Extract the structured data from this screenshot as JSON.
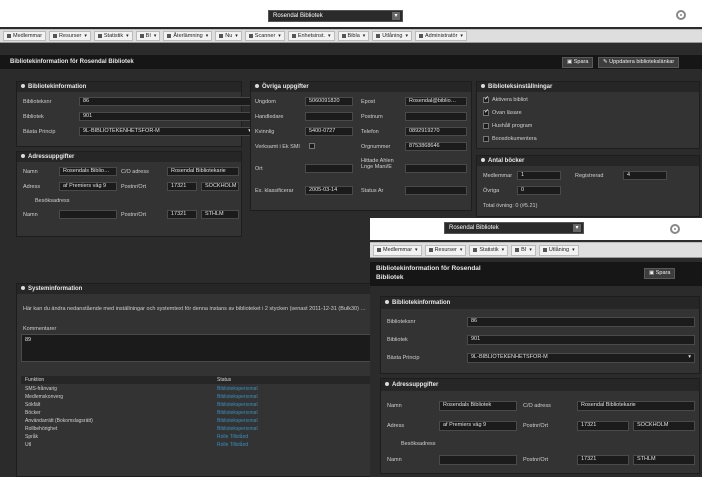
{
  "app": {
    "title": "Rosendal Bibliotek"
  },
  "menu": [
    {
      "label": "Medlemmar",
      "dropdown": false
    },
    {
      "label": "Resurser",
      "dropdown": true
    },
    {
      "label": "Statistik",
      "dropdown": true
    },
    {
      "label": "BI",
      "dropdown": true
    },
    {
      "label": "Återlämning",
      "dropdown": true
    },
    {
      "label": "Nu",
      "dropdown": true
    },
    {
      "label": "Scanner",
      "dropdown": true
    },
    {
      "label": "Enhetsinst.",
      "dropdown": true
    },
    {
      "label": "Bibla",
      "dropdown": true
    },
    {
      "label": "Utlåning",
      "dropdown": true
    },
    {
      "label": "Administratör",
      "dropdown": true
    }
  ],
  "page": {
    "title": "Bibliotekinformation för Rosendal Bibliotek",
    "save_label": "Spara",
    "action_label": "Uppdatera bibliotekslänkar"
  },
  "library_info": {
    "heading": "Bibliotekinformation",
    "fields": [
      {
        "label": "Biblioteksnr",
        "value": "86"
      },
      {
        "label": "Bibliotek",
        "value": "901"
      },
      {
        "label": "Bästa Princip",
        "value": "9L-BIBLIOTEKENHETSFÖR-M"
      }
    ]
  },
  "address": {
    "heading": "Adressuppgifter",
    "name_label": "Namn",
    "name_value": "Rosendals Biblio…",
    "co_label": "C/O adress",
    "co_value": "Rosendal Bibliotekarie",
    "street_label": "Adress",
    "street_value": "af Premiers väg 9",
    "zip_label": "Postnr/Ort",
    "zip_value": "17321",
    "city_value": "SOCKHOLM",
    "visit_label": "Besöksadress",
    "visit_name_label": "Namn",
    "visit_zip_label": "Postnr/Ort",
    "visit_zip_value": "17321",
    "visit_city_value": "STHLM"
  },
  "other": {
    "heading": "Övriga uppgifter",
    "left": [
      {
        "label": "Ungdom",
        "value": "5060091820"
      },
      {
        "label": "Handledare",
        "value": ""
      },
      {
        "label": "Kvinnlig",
        "value": "5400-0727"
      },
      {
        "label": "Verksamt i Ek SMI",
        "value": ""
      },
      {
        "label": "Ort",
        "value": ""
      },
      {
        "label": "Ex. klassificerar",
        "value": "2005-03-14"
      }
    ],
    "right": [
      {
        "label": "Epost",
        "value": "Rosendal@biblio…"
      },
      {
        "label": "Postnum",
        "value": ""
      },
      {
        "label": "Telefon",
        "value": "0892919270"
      },
      {
        "label": "Orgnummer",
        "value": "8753868646"
      },
      {
        "label": "Hittade Ahlen Lnge Mani/E",
        "value": ""
      },
      {
        "label": "Status Ar",
        "value": ""
      }
    ]
  },
  "settings": {
    "heading": "Biblioteksinställningar",
    "options": [
      {
        "label": "Aktivera bibliot",
        "checked": true
      },
      {
        "label": "Ovan läsare",
        "checked": true
      },
      {
        "label": "Hushåll program",
        "checked": false
      },
      {
        "label": "Boosdokumentera",
        "checked": false
      }
    ]
  },
  "counts": {
    "heading": "Antal böcker",
    "members_label": "Medlemmar",
    "members_value": "1",
    "books_label": "Registrerad",
    "books_value": "4",
    "loans_label": "Övriga",
    "loans_value": "0",
    "total_text": "Total övning: 0 (#5.21)"
  },
  "system": {
    "heading": "Systeminformation",
    "desc": "Här kan du ändra nedanstående med inställningar och systemtext för denna instans av biblioteket i 2 stycken (senast 2011-12-31 (Bulk30) …",
    "comment_label": "Kommentarer",
    "comment_value": "89",
    "table_headers": [
      "Funktion",
      "Status"
    ],
    "rows": [
      {
        "name": "SMS-frånvarig",
        "status": "Bibliotekspersonal"
      },
      {
        "name": "Medlemskonverg",
        "status": "Bibliotekspersonal"
      },
      {
        "name": "Sökfält",
        "status": "Bibliotekspersonal"
      },
      {
        "name": "Böcker",
        "status": "Bibliotekspersonal"
      },
      {
        "name": "Användar­rätt (Bokomslagsrätt)",
        "status": "Bibliotekspersonal"
      },
      {
        "name": "Rollbehörighet",
        "status": "Bibliotekspersonal"
      },
      {
        "name": "Språk",
        "status": "Rolle Tillstånd"
      },
      {
        "name": "Utl",
        "status": "Rolle Tillstånd"
      }
    ]
  },
  "overlay": {
    "app_title": "Rosendal Bibliotek",
    "menu": [
      {
        "label": "Medlemmar"
      },
      {
        "label": "Resurser"
      },
      {
        "label": "Statistik"
      },
      {
        "label": "BI"
      },
      {
        "label": "Utlåning"
      }
    ],
    "page_title_1": "Bibliotekinformation för Rosendal",
    "page_title_2": "Bibliotek",
    "save_label": "Spara",
    "library_heading": "Bibliotekinformation",
    "fields": [
      {
        "label": "Biblioteksnr",
        "value": "86"
      },
      {
        "label": "Bibliotek",
        "value": "901"
      },
      {
        "label": "Bästa Princip",
        "value": "9L-BIBLIOTEKENHETSFÖR-M"
      }
    ],
    "address_heading": "Adressuppgifter",
    "name_label": "Namn",
    "name_value": "Rosendals Bibliotek",
    "co_label": "C/O adress",
    "co_value": "Rosendal Bibliotekarie",
    "street_label": "Adress",
    "street_value": "af Premiers väg 9",
    "zip_label": "Postnr/Ort",
    "zip_value": "17321",
    "city_value": "SOCKHOLM",
    "visit_label": "Besöksadress",
    "visit_name_label": "Namn",
    "visit_zip_label": "Postnr/Ort",
    "visit_zip_value": "17321",
    "visit_city_value": "STHLM"
  }
}
